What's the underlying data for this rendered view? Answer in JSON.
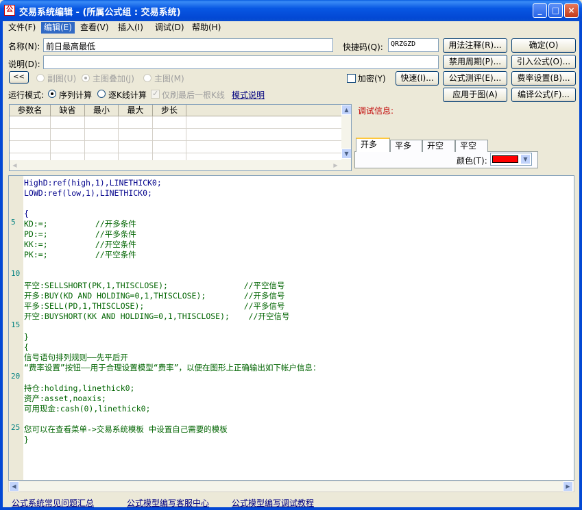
{
  "window": {
    "title": "交易系统编辑 - (所属公式组 : 交易系统)",
    "app_icon": "公",
    "minimize": "_",
    "maximize": "□",
    "close": "×"
  },
  "menu": [
    "文件(F)",
    "编辑(E)",
    "查看(V)",
    "插入(I)",
    "调试(D)",
    "帮助(H)"
  ],
  "form": {
    "name_label": "名称(N):",
    "name_value": "前日最高最低",
    "shortcut_label": "快捷码(Q):",
    "shortcut_value": "QRZGZD",
    "desc_label": "说明(D):",
    "desc_value": "",
    "collapse_btn": "<<",
    "radio_sub": "副图(U)",
    "radio_main_overlay": "主图叠加(J)",
    "radio_main": "主图(M)",
    "encrypt_label": "加密(Y)",
    "quick_btn": "快速(I)...",
    "run_mode_label": "运行模式:",
    "mode_sequence": "序列计算",
    "mode_kline": "逐K线计算",
    "mode_lastbar": "仅刷最后一根K线",
    "mode_help_link": "模式说明"
  },
  "right_buttons": [
    "用法注释(R)...",
    "确定(O)",
    "禁用周期(P)...",
    "引入公式(O)...",
    "公式测评(E)...",
    "费率设置(B)...",
    "应用于图(A)",
    "编译公式(F)..."
  ],
  "param_table": {
    "headers": [
      "参数名",
      "缺省",
      "最小",
      "最大",
      "步长"
    ]
  },
  "debug": {
    "label": "调试信息:",
    "tabs": [
      "开多",
      "平多",
      "开空",
      "平空"
    ],
    "color_label": "颜色(T):",
    "color_value": "#ff0000"
  },
  "editor": {
    "line_numbers": [
      "5",
      "10",
      "15",
      "20",
      "25"
    ],
    "lines": [
      "HighD:ref(high,1),LINETHICK0;",
      "LOWD:ref(low,1),LINETHICK0;",
      "",
      "{",
      "KD:=;          //开多条件",
      "PD:=;          //平多条件",
      "KK:=;          //开空条件",
      "PK:=;          //平空条件",
      "",
      "",
      "平空:SELLSHORT(PK,1,THISCLOSE);                //平空信号",
      "开多:BUY(KD AND HOLDING=0,1,THISCLOSE);        //开多信号",
      "平多:SELL(PD,1,THISCLOSE);                     //平多信号",
      "开空:BUYSHORT(KK AND HOLDING=0,1,THISCLOSE);    //开空信号",
      "",
      "}",
      "{",
      "信号语句排列规则——先平后开",
      "“费率设置”按钮——用于合理设置模型“费率”，以便在图形上正确输出如下帐户信息：",
      "",
      "持仓:holding,linethick0;",
      "资产:asset,noaxis;",
      "可用现金:cash(0),linethick0;",
      "",
      "您可以在查看菜单->交易系统模板 中设置自己需要的模板",
      "}"
    ]
  },
  "footer_links": [
    "公式系统常见问题汇总",
    "公式模型编写客服中心",
    "公式模型编写调试教程"
  ]
}
